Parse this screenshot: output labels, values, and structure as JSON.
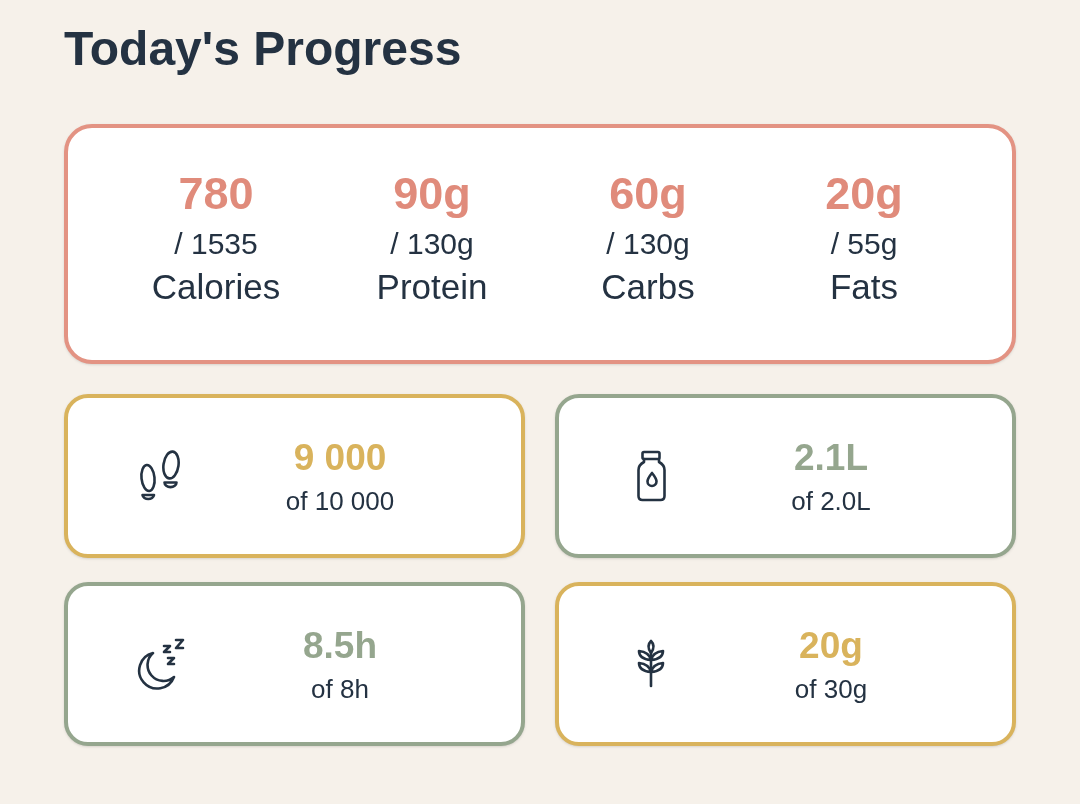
{
  "title": "Today's Progress",
  "macros": [
    {
      "value": "780",
      "target": "/ 1535",
      "label": "Calories"
    },
    {
      "value": "90g",
      "target": "/ 130g",
      "label": "Protein"
    },
    {
      "value": "60g",
      "target": "/ 130g",
      "label": "Carbs"
    },
    {
      "value": "20g",
      "target": "/ 55g",
      "label": "Fats"
    }
  ],
  "tiles": [
    {
      "kind": "steps",
      "value": "9 000",
      "target": "of 10 000",
      "color": "#d9b35c"
    },
    {
      "kind": "water",
      "value": "2.1L",
      "target": "of 2.0L",
      "color": "#95a68e"
    },
    {
      "kind": "sleep",
      "value": "8.5h",
      "target": "of 8h",
      "color": "#95a68e"
    },
    {
      "kind": "fiber",
      "value": "20g",
      "target": "of 30g",
      "color": "#d9b35c"
    }
  ]
}
